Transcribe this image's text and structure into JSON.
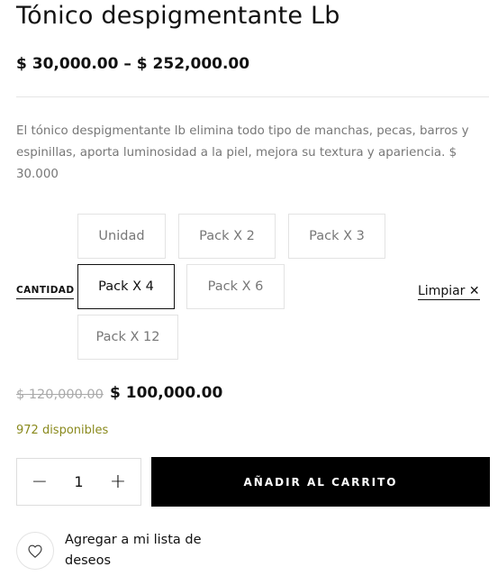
{
  "product": {
    "title": "Tónico despigmentante Lb",
    "price_range": "$ 30,000.00 – $ 252,000.00",
    "description": "El tónico despigmentante lb elimina todo tipo de manchas, pecas, barros y espinillas, aporta luminosidad a la piel, mejora su textura y apariencia. $ 30.000"
  },
  "variations": {
    "label": "CANTIDAD",
    "options": [
      "Unidad",
      "Pack X 2",
      "Pack X 3",
      "Pack X 4",
      "Pack X 6",
      "Pack X 12"
    ],
    "selected": "Pack X 4",
    "clear_label": "Limpiar ✕"
  },
  "selected_variant": {
    "old_price": "$ 120,000.00",
    "new_price": "$ 100,000.00",
    "stock": "972 disponibles"
  },
  "cart": {
    "quantity": "1",
    "minus": "−",
    "plus": "+",
    "add_label": "AÑADIR AL CARRITO"
  },
  "wishlist": {
    "label": "Agregar a mi lista de deseos",
    "icon": "heart-icon"
  },
  "colors": {
    "primary_button": "#000000",
    "stock_text": "#8a8a1e",
    "muted_text": "#777777"
  }
}
